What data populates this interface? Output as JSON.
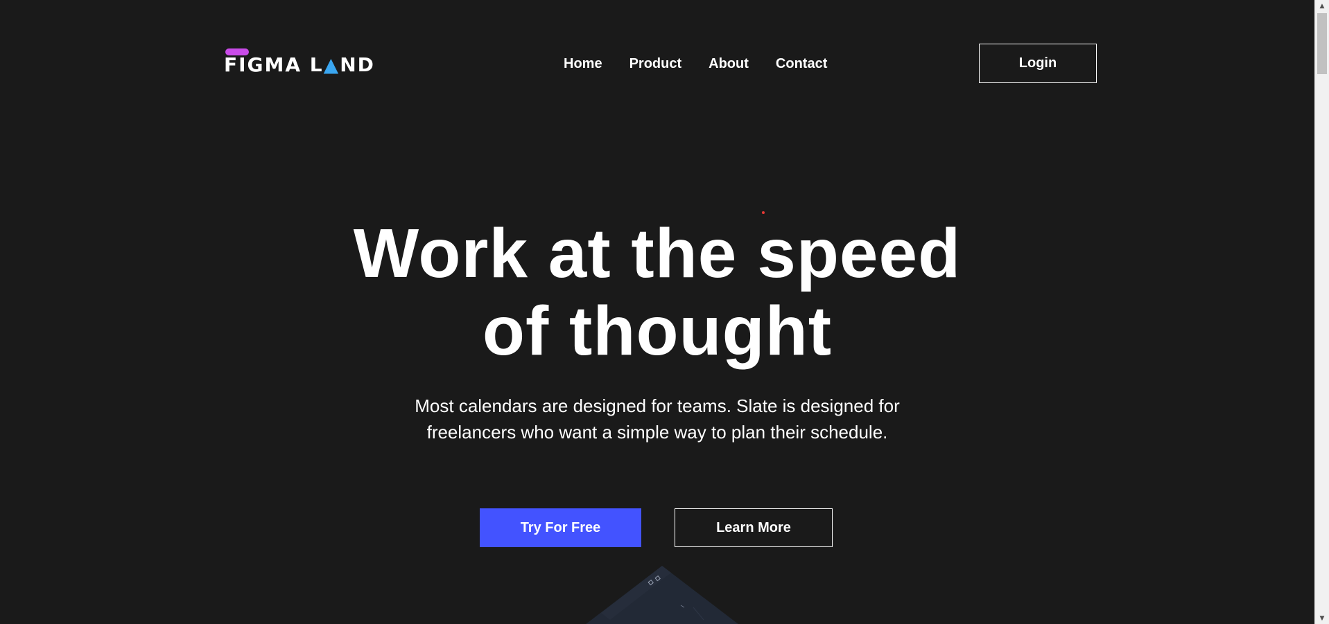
{
  "brand": {
    "logo_text_left": "FIGMA L",
    "logo_triangle": "▲",
    "logo_text_right": "ND",
    "accent_bar_color": "#c94be8",
    "triangle_color": "#3aa6f0"
  },
  "nav": {
    "items": [
      {
        "label": "Home"
      },
      {
        "label": "Product"
      },
      {
        "label": "About"
      },
      {
        "label": "Contact"
      }
    ],
    "login_label": "Login"
  },
  "hero": {
    "title_line1": "Work at the speed",
    "title_line2": "of thought",
    "subtitle_line1": "Most calendars are designed for teams. Slate is designed for",
    "subtitle_line2": "freelancers who want a simple way to plan their schedule.",
    "primary_cta": "Try For Free",
    "secondary_cta": "Learn More",
    "primary_color": "#4353ff"
  },
  "colors": {
    "background": "#1a1a1a",
    "text": "#ffffff"
  },
  "scrollbar": {
    "up_icon": "▲",
    "down_icon": "▼"
  }
}
